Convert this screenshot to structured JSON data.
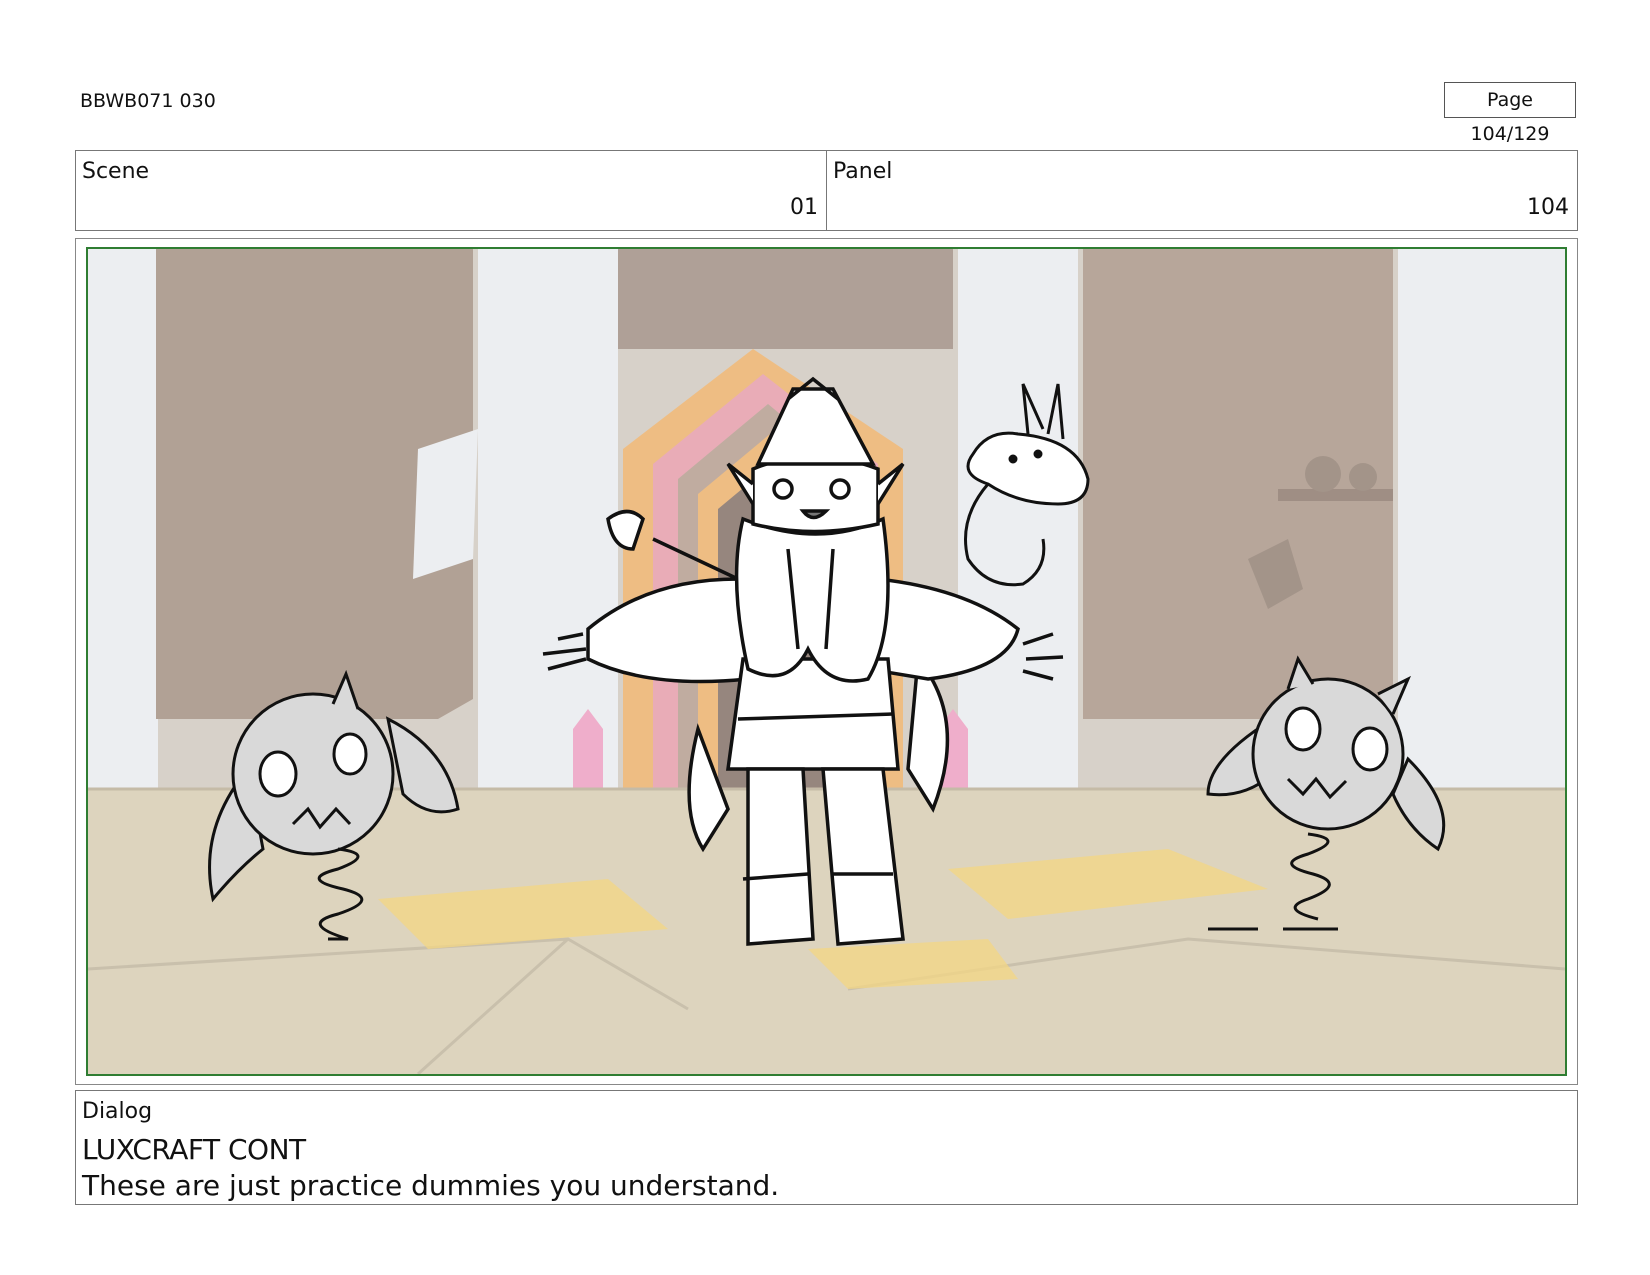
{
  "header": {
    "document_id": "BBWB071 030",
    "page_label": "Page 104/129"
  },
  "info": {
    "scene_label": "Scene",
    "scene_value": "01",
    "panel_label": "Panel",
    "panel_value": "104"
  },
  "dialog": {
    "label": "Dialog",
    "speaker": "LUXCRAFT CONT",
    "line": "These are just practice dummies you understand."
  },
  "colors": {
    "frame_border": "#2f7d32",
    "wall": "#a08d7e",
    "pillar": "#e8ebee",
    "floor": "#d6cbb0",
    "floor_glow": "#f1cd6a",
    "door_pink": "#e49aa8",
    "door_orange": "#ebaf68",
    "crystal": "#ec9dc0",
    "dummy_fill": "#d9d9d9"
  }
}
